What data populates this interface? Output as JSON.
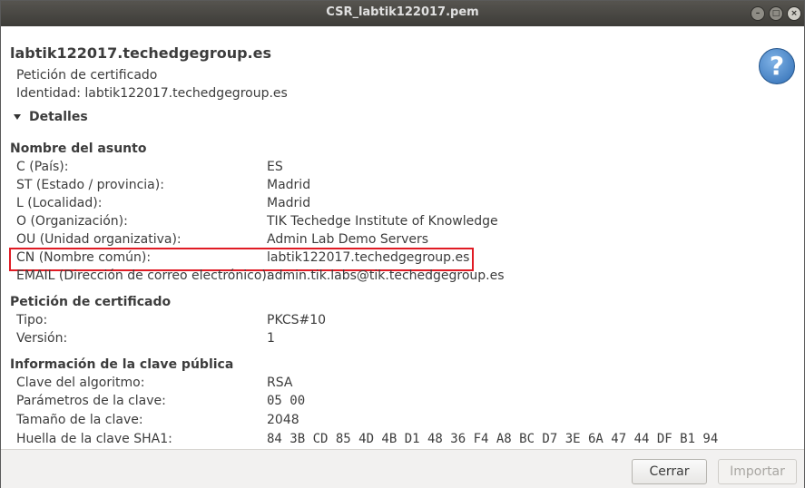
{
  "window": {
    "title": "CSR_labtik122017.pem",
    "buttons": [
      "–",
      "□",
      "×"
    ]
  },
  "header": {
    "common_name": "labtik122017.techedgegroup.es",
    "type": "Petición de certificado",
    "identity": "Identidad: labtik122017.techedgegroup.es",
    "help_symbol": "?"
  },
  "details_toggle": "Detalles",
  "sections": {
    "subject": {
      "heading": "Nombre del asunto",
      "rows": [
        {
          "label": "C (País):",
          "value": "ES"
        },
        {
          "label": "ST (Estado / provincia):",
          "value": "Madrid"
        },
        {
          "label": "L (Localidad):",
          "value": "Madrid"
        },
        {
          "label": "O (Organización):",
          "value": "TIK Techedge Institute of Knowledge"
        },
        {
          "label": "OU (Unidad organizativa):",
          "value": "Admin Lab Demo Servers"
        },
        {
          "label": "CN (Nombre común):",
          "value": "labtik122017.techedgegroup.es"
        },
        {
          "label": "EMAIL (Dirección de correo electrónico):",
          "value": "admin.tik.labs@tik.techedgegroup.es"
        }
      ]
    },
    "request": {
      "heading": "Petición de certificado",
      "rows": [
        {
          "label": "Tipo:",
          "value": "PKCS#10"
        },
        {
          "label": "Versión:",
          "value": "1"
        }
      ]
    },
    "public_key": {
      "heading": "Información de la clave pública",
      "rows": [
        {
          "label": "Clave del algoritmo:",
          "value": "RSA"
        },
        {
          "label": "Parámetros de la clave:",
          "value": "05 00"
        },
        {
          "label": "Tamaño de la clave:",
          "value": "2048"
        },
        {
          "label": "Huella de la clave SHA1:",
          "value": "84 3B CD 85 4D 4B D1 48 36 F4 A8 BC D7 3E 6A 47 44 DF B1 94"
        }
      ]
    }
  },
  "footer": {
    "close_label": "Cerrar",
    "import_label": "Importar"
  }
}
